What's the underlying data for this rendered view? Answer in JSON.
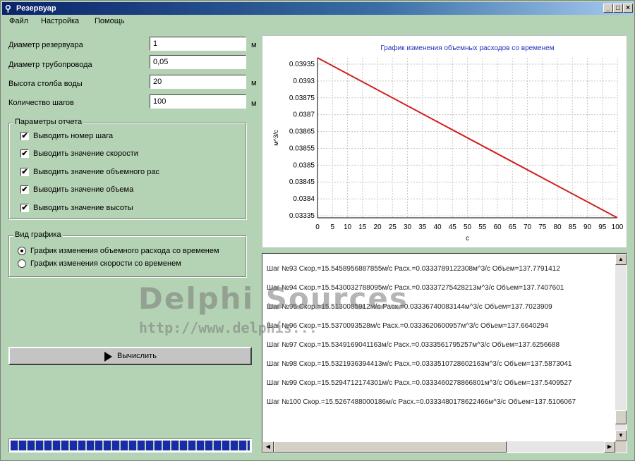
{
  "window": {
    "title": "Резервуар",
    "buttons": [
      "_",
      "□",
      "×"
    ]
  },
  "menu": [
    "Файл",
    "Настройка",
    "Помощь"
  ],
  "params": [
    {
      "label": "Диаметр резервуара",
      "value": "1",
      "unit": "м"
    },
    {
      "label": "Диаметр трубопровода",
      "value": "0,05",
      "unit": ""
    },
    {
      "label": "Высота столба воды",
      "value": "20",
      "unit": "м"
    },
    {
      "label": "Количество шагов",
      "value": "100",
      "unit": "м"
    }
  ],
  "report": {
    "title": "Параметры отчета",
    "options": [
      {
        "label": "Выводить номер шага",
        "checked": true
      },
      {
        "label": "Выводить значение скорости",
        "checked": true
      },
      {
        "label": "Выводить значение объемного рас",
        "checked": true
      },
      {
        "label": "Выводить значение объема",
        "checked": true
      },
      {
        "label": "Выводить значение высоты",
        "checked": true
      }
    ]
  },
  "chart_type": {
    "title": "Вид графика",
    "options": [
      {
        "label": "График изменения объемного расхода со временем",
        "selected": true
      },
      {
        "label": "График изменения скорости со временем",
        "selected": false
      }
    ]
  },
  "compute_button": "Вычислить",
  "progress": {
    "fraction": 1.0
  },
  "chart_data": {
    "type": "line",
    "title": "График изменения объемных расходов со временем",
    "xlabel": "с",
    "ylabel": "м^3/с",
    "x": [
      0,
      100
    ],
    "y": [
      0.03935,
      0.03335
    ],
    "xlim": [
      0,
      100
    ],
    "ylim": [
      0.03335,
      0.03935
    ],
    "xticks": [
      "0",
      "5",
      "10",
      "15",
      "20",
      "25",
      "30",
      "35",
      "40",
      "45",
      "50",
      "55",
      "60",
      "65",
      "70",
      "75",
      "80",
      "85",
      "90",
      "95",
      "100"
    ],
    "yticks": [
      "0.03935",
      "0.0393",
      "0.03875",
      "0.0387",
      "0.03865",
      "0.03855",
      "0.0385",
      "0.03845",
      "0.0384",
      "0.03335"
    ],
    "grid": true,
    "line_color": "#d42020"
  },
  "log": [
    "Шаг №93   Скор.=15.5458956887855м/с  Расх.=0.0333789122308м^3/с  Объем=137.7791412",
    "Шаг №94   Скор.=15.5430032788095м/с  Расх.=0.03337275428213м^3/с  Объем=137.7407601",
    "Шаг №95   Скор.=15.5130085912м/с  Расх.=0.03336740083144м^3/с  Объем=137.7023909",
    "Шаг №96   Скор.=15.5370093528м/с  Расх.=0.0333620600957м^3/с  Объем=137.6640294",
    "Шаг №97   Скор.=15.5349169041163м/с  Расх.=0.0333561795257м^3/с  Объем=137.6256688",
    "Шаг №98   Скор.=15.5321936394413м/с  Расх.=0.0333510728602163м^3/с  Объем=137.5873041",
    "Шаг №99   Скор.=15.5294712174301м/с  Расх.=0.0333460278866801м^3/с  Объем=137.5409527",
    "Шаг №100  Скор.=15.5267488000186м/с  Расх.=0.0333480178622466м^3/с  Объем=137.5106067"
  ],
  "watermark": {
    "line1": "Delphi Sources",
    "line2": "http://www.delphis..."
  }
}
